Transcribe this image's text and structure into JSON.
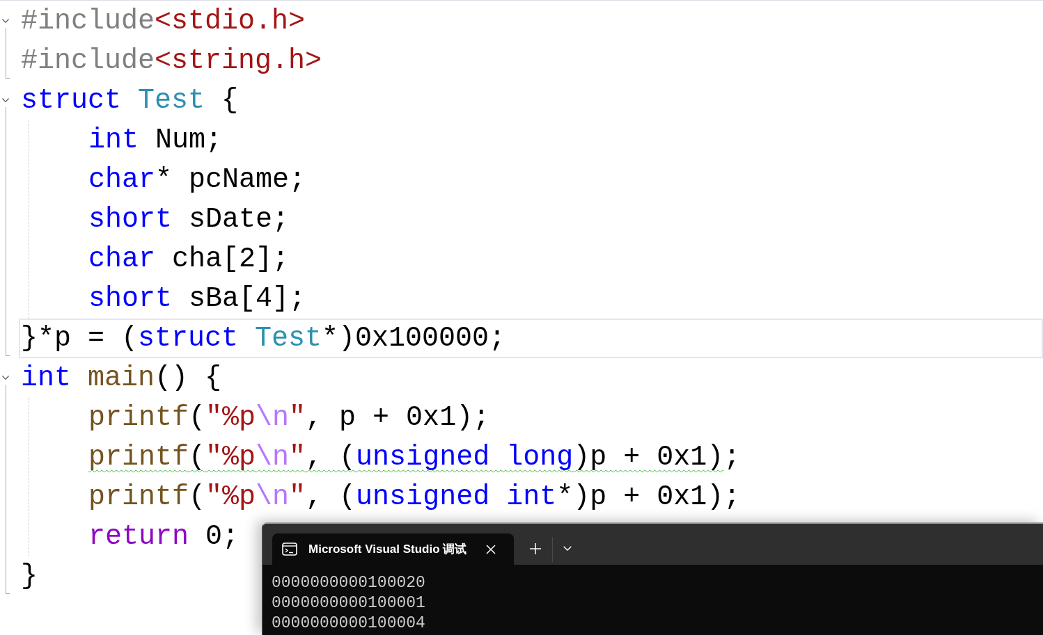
{
  "editor": {
    "blocks": [
      {
        "kind": "region",
        "expanded": true,
        "lines": [
          {
            "current": false,
            "tokens": [
              {
                "kind": "preprocessor",
                "text": "#include"
              },
              {
                "kind": "include_path",
                "text": "<stdio.h>"
              }
            ]
          },
          {
            "current": false,
            "tokens": [
              {
                "kind": "preprocessor",
                "text": "#include"
              },
              {
                "kind": "include_path",
                "text": "<string.h>"
              }
            ]
          }
        ]
      },
      {
        "kind": "block",
        "expanded": true,
        "header": {
          "current": false,
          "tokens": [
            {
              "kind": "keyword",
              "text": "struct "
            },
            {
              "kind": "type",
              "text": "Test"
            },
            {
              "kind": "plain",
              "text": " {"
            }
          ]
        },
        "children": [
          {
            "current": false,
            "tokens": [
              {
                "kind": "keyword",
                "text": "int "
              },
              {
                "kind": "plain",
                "text": "Num;"
              }
            ]
          },
          {
            "current": false,
            "tokens": [
              {
                "kind": "keyword",
                "text": "char"
              },
              {
                "kind": "plain",
                "text": "* pcName;"
              }
            ]
          },
          {
            "current": false,
            "tokens": [
              {
                "kind": "keyword",
                "text": "short "
              },
              {
                "kind": "plain",
                "text": "sDate;"
              }
            ]
          },
          {
            "current": false,
            "tokens": [
              {
                "kind": "keyword",
                "text": "char "
              },
              {
                "kind": "plain",
                "text": "cha[2];"
              }
            ]
          },
          {
            "current": false,
            "tokens": [
              {
                "kind": "keyword",
                "text": "short "
              },
              {
                "kind": "plain",
                "text": "sBa[4];"
              }
            ]
          }
        ],
        "footer": {
          "current": true,
          "tokens": [
            {
              "kind": "plain",
              "text": "}*p = ("
            },
            {
              "kind": "keyword",
              "text": "struct "
            },
            {
              "kind": "type",
              "text": "Test"
            },
            {
              "kind": "plain",
              "text": "*)0x100000;"
            }
          ]
        }
      },
      {
        "kind": "block",
        "expanded": true,
        "header": {
          "current": false,
          "tokens": [
            {
              "kind": "keyword",
              "text": "int "
            },
            {
              "kind": "function",
              "text": "main"
            },
            {
              "kind": "plain",
              "text": "() {"
            }
          ]
        },
        "children": [
          {
            "current": false,
            "tokens": [
              {
                "kind": "function",
                "text": "printf"
              },
              {
                "kind": "plain",
                "text": "("
              },
              {
                "kind": "string",
                "text": "\"%p"
              },
              {
                "kind": "escape",
                "text": "\\n"
              },
              {
                "kind": "string",
                "text": "\""
              },
              {
                "kind": "plain",
                "text": ", p + 0x1);"
              }
            ]
          },
          {
            "current": false,
            "tokens": [
              {
                "kind": "function",
                "text": "printf",
                "warning": true
              },
              {
                "kind": "plain",
                "text": "(",
                "warning": true
              },
              {
                "kind": "string",
                "text": "\"%p",
                "warning": true
              },
              {
                "kind": "escape",
                "text": "\\n",
                "warning": true
              },
              {
                "kind": "string",
                "text": "\"",
                "warning": true
              },
              {
                "kind": "plain",
                "text": ", (",
                "warning": true
              },
              {
                "kind": "keyword",
                "text": "unsigned long",
                "warning": true
              },
              {
                "kind": "plain",
                "text": ")p + 0x1)",
                "warning": true
              },
              {
                "kind": "plain",
                "text": ";",
                "warning": false
              }
            ]
          },
          {
            "current": false,
            "tokens": [
              {
                "kind": "function",
                "text": "printf"
              },
              {
                "kind": "plain",
                "text": "("
              },
              {
                "kind": "string",
                "text": "\"%p"
              },
              {
                "kind": "escape",
                "text": "\\n"
              },
              {
                "kind": "string",
                "text": "\""
              },
              {
                "kind": "plain",
                "text": ", ("
              },
              {
                "kind": "keyword",
                "text": "unsigned int"
              },
              {
                "kind": "plain",
                "text": "*)p + 0x1);"
              }
            ]
          },
          {
            "current": false,
            "tokens": [
              {
                "kind": "control",
                "text": "return "
              },
              {
                "kind": "plain",
                "text": "0;"
              }
            ]
          }
        ],
        "footer": {
          "current": false,
          "tokens": [
            {
              "kind": "plain",
              "text": "}"
            }
          ]
        }
      }
    ]
  },
  "terminal": {
    "tabs": [
      {
        "title": "Microsoft Visual Studio 调试",
        "selected": true
      }
    ],
    "output": [
      "0000000000100020",
      "0000000000100001",
      "0000000000100004"
    ]
  }
}
